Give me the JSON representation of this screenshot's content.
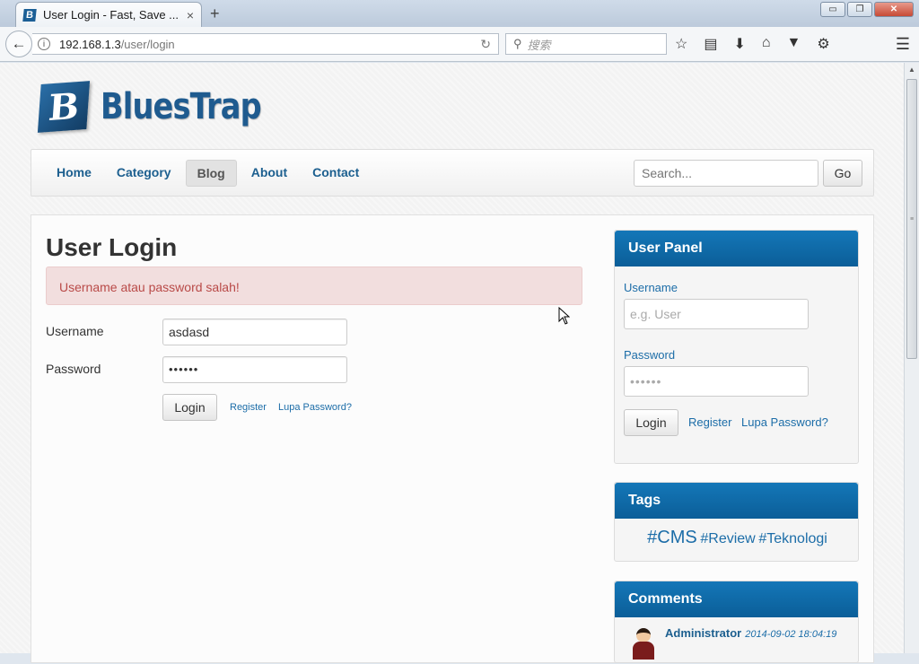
{
  "browser": {
    "tab_title": "User Login - Fast, Save ...",
    "tab_favicon": "B",
    "tab_close": "×",
    "new_tab": "+",
    "url_host": "192.168.1.3",
    "url_path": "/user/login",
    "search_placeholder": "搜索",
    "window_minimize": "▭",
    "window_restore": "❐",
    "window_close": "✕"
  },
  "site": {
    "logo_letter": "B",
    "logo_text": "BluesTrap",
    "nav": [
      "Home",
      "Category",
      "Blog",
      "About",
      "Contact"
    ],
    "active_nav": "Blog",
    "search_placeholder": "Search...",
    "go_label": "Go"
  },
  "login": {
    "title": "User Login",
    "error": "Username atau password salah!",
    "username_label": "Username",
    "username_value": "asdasd",
    "password_label": "Password",
    "password_value": "••••••",
    "login_button": "Login",
    "register_link": "Register",
    "forgot_link": "Lupa Password?"
  },
  "user_panel": {
    "title": "User Panel",
    "username_label": "Username",
    "username_placeholder": "e.g. User",
    "password_label": "Password",
    "password_placeholder": "••••••",
    "login_button": "Login",
    "register_link": "Register",
    "forgot_link": "Lupa Password?"
  },
  "tags": {
    "title": "Tags",
    "items": [
      "#CMS",
      "#Review",
      "#Teknologi"
    ]
  },
  "comments": {
    "title": "Comments",
    "author": "Administrator",
    "date": "2014-09-02 18:04:19"
  },
  "colors": {
    "accent": "#1c6da8",
    "panel_header": "#0b5e98",
    "alert_bg": "#f2dede",
    "alert_text": "#b94a48"
  }
}
